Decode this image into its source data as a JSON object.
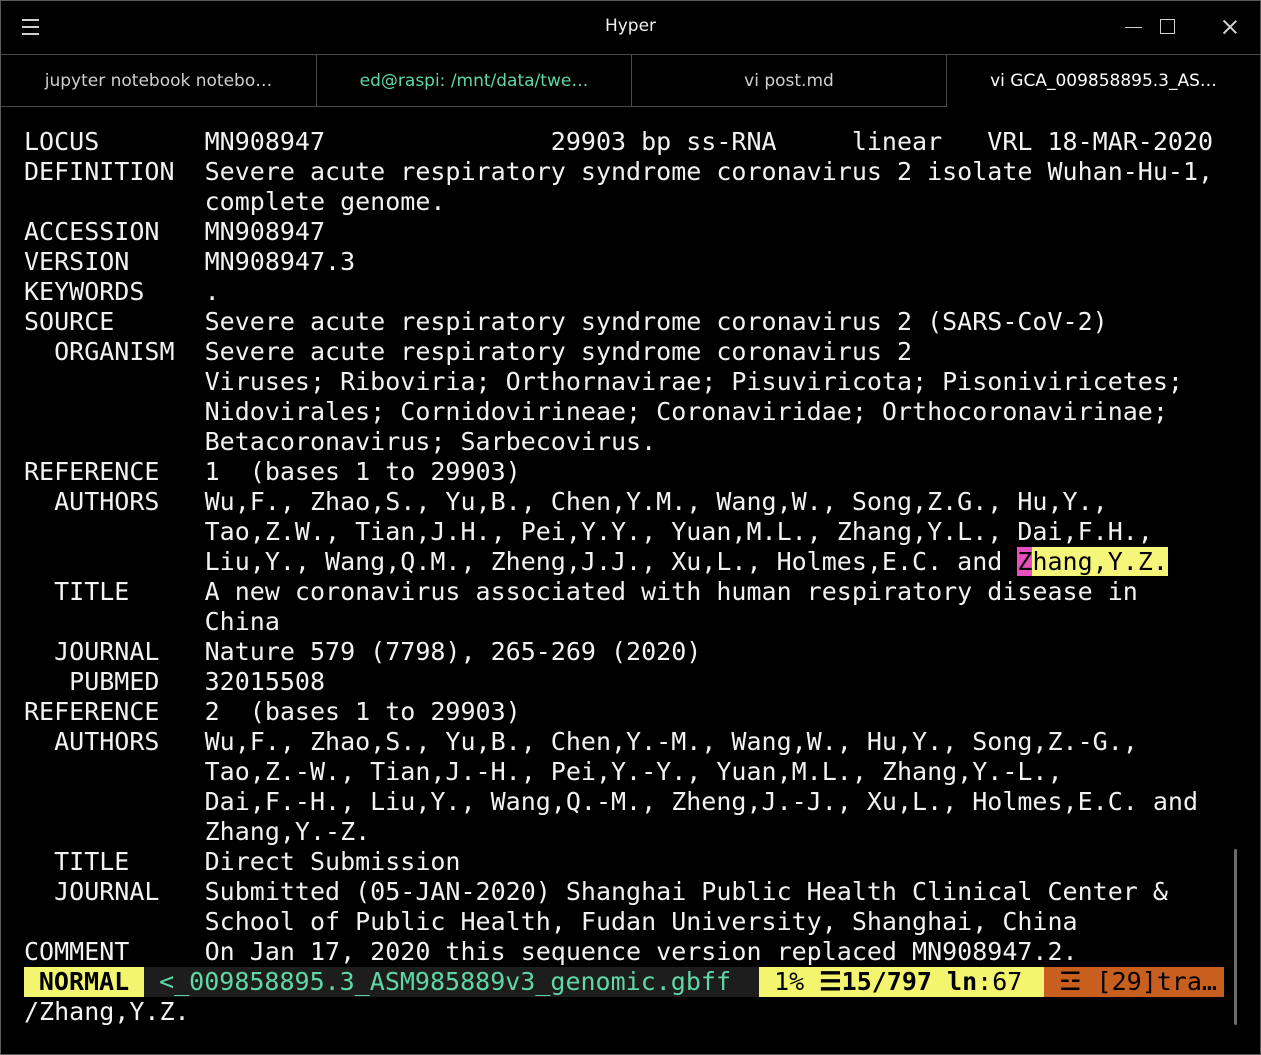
{
  "window": {
    "title": "Hyper"
  },
  "tabs": [
    {
      "label": "jupyter notebook notebo…"
    },
    {
      "label": "ed@raspi: /mnt/data/twe…"
    },
    {
      "label": "vi post.md"
    },
    {
      "label": "vi GCA_009858895.3_AS…"
    }
  ],
  "content": {
    "lines": [
      "LOCUS       MN908947               29903 bp ss-RNA     linear   VRL 18-MAR-2020",
      "DEFINITION  Severe acute respiratory syndrome coronavirus 2 isolate Wuhan-Hu-1,",
      "            complete genome.",
      "ACCESSION   MN908947",
      "VERSION     MN908947.3",
      "KEYWORDS    .",
      "SOURCE      Severe acute respiratory syndrome coronavirus 2 (SARS-CoV-2)",
      "  ORGANISM  Severe acute respiratory syndrome coronavirus 2",
      "            Viruses; Riboviria; Orthornavirae; Pisuviricota; Pisoniviricetes;",
      "            Nidovirales; Cornidovirineae; Coronaviridae; Orthocoronavirinae;",
      "            Betacoronavirus; Sarbecovirus.",
      "REFERENCE   1  (bases 1 to 29903)",
      "  AUTHORS   Wu,F., Zhao,S., Yu,B., Chen,Y.M., Wang,W., Song,Z.G., Hu,Y.,",
      "            Tao,Z.W., Tian,J.H., Pei,Y.Y., Yuan,M.L., Zhang,Y.L., Dai,F.H.,",
      null,
      "  TITLE     A new coronavirus associated with human respiratory disease in",
      "            China",
      "  JOURNAL   Nature 579 (7798), 265-269 (2020)",
      "   PUBMED   32015508",
      "REFERENCE   2  (bases 1 to 29903)",
      "  AUTHORS   Wu,F., Zhao,S., Yu,B., Chen,Y.-M., Wang,W., Hu,Y., Song,Z.-G.,",
      "            Tao,Z.-W., Tian,J.-H., Pei,Y.-Y., Yuan,M.L., Zhang,Y.-L.,",
      "            Dai,F.-H., Liu,Y., Wang,Q.-M., Zheng,J.-J., Xu,L., Holmes,E.C. and",
      "            Zhang,Y.-Z.",
      "  TITLE     Direct Submission",
      "  JOURNAL   Submitted (05-JAN-2020) Shanghai Public Health Clinical Center &",
      "            School of Public Health, Fudan University, Shanghai, China",
      "COMMENT     On Jan 17, 2020 this sequence version replaced MN908947.2."
    ],
    "match_line": {
      "before": "            Liu,Y., Wang,Q.M., Zheng,J.J., Xu,L., Holmes,E.C. and ",
      "cursor_char": "Z",
      "match_rest": "hang,Y.Z."
    }
  },
  "statusline": {
    "mode": "NORMAL",
    "filename": "<_009858895.3_ASM985889v3_genomic.gbff",
    "percent": "1%",
    "lines_icon": "☰",
    "position": "15/797",
    "ln_label": "ln",
    "column": ":67",
    "tag_icon": "☲",
    "tag": "[29]tra…"
  },
  "cmdline": "/Zhang,Y.Z.",
  "colors": {
    "background": "#000000",
    "foreground": "#f2f2f2",
    "search_highlight": "#f5f57a",
    "cursor": "#e64fbd",
    "status_yellow": "#f4f56f",
    "status_orange": "#c85f1f",
    "active_tab_alt": "#5fd7a6"
  }
}
